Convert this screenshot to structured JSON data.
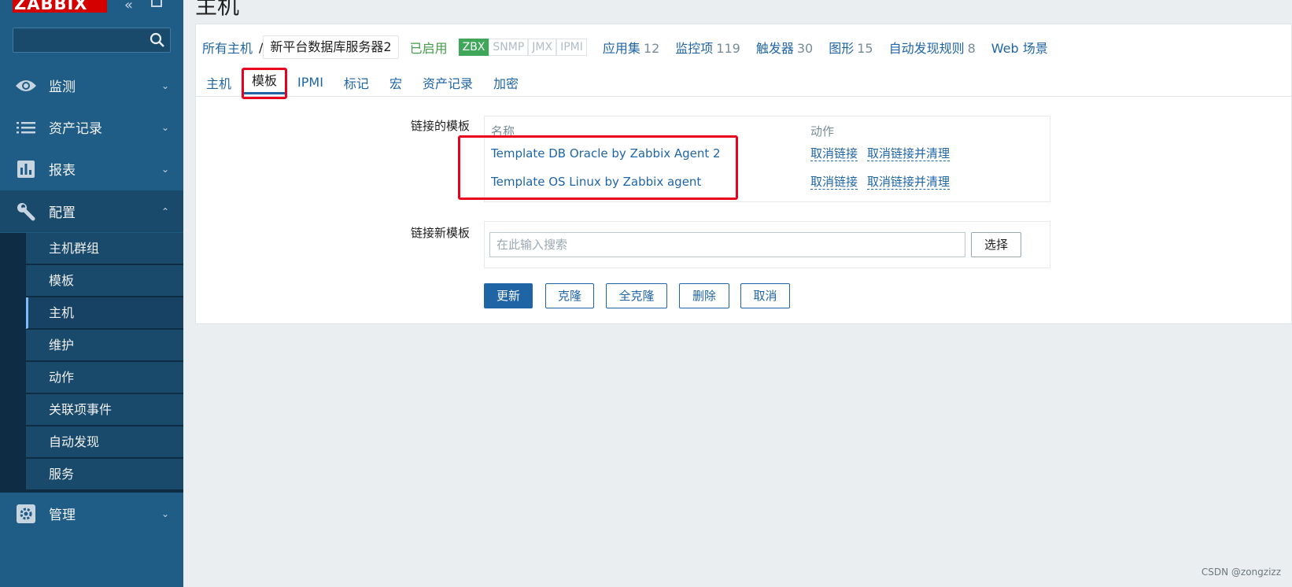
{
  "sidebar": {
    "logo": "ZABBIX",
    "collapse_glyph": "«",
    "nav": [
      {
        "label": "监测",
        "icon": "eye-icon"
      },
      {
        "label": "资产记录",
        "icon": "list-icon"
      },
      {
        "label": "报表",
        "icon": "bar-chart-icon"
      },
      {
        "label": "配置",
        "icon": "wrench-icon"
      },
      {
        "label": "管理",
        "icon": "gear-icon"
      }
    ],
    "config_items": [
      "主机群组",
      "模板",
      "主机",
      "维护",
      "动作",
      "关联项事件",
      "自动发现",
      "服务"
    ],
    "active_item": "主机"
  },
  "page": {
    "title": "主机"
  },
  "breadcrumb": {
    "all_hosts": "所有主机",
    "separator": "/",
    "current_host": "新平台数据库服务器2",
    "status": "已启用"
  },
  "availability": [
    "ZBX",
    "SNMP",
    "JMX",
    "IPMI"
  ],
  "host_links": [
    {
      "label": "应用集",
      "count": "12"
    },
    {
      "label": "监控项",
      "count": "119"
    },
    {
      "label": "触发器",
      "count": "30"
    },
    {
      "label": "图形",
      "count": "15"
    },
    {
      "label": "自动发现规则",
      "count": "8"
    },
    {
      "label": "Web 场景",
      "count": ""
    }
  ],
  "tabs": [
    "主机",
    "模板",
    "IPMI",
    "标记",
    "宏",
    "资产记录",
    "加密"
  ],
  "active_tab": "模板",
  "form": {
    "linked_label": "链接的模板",
    "col_name": "名称",
    "col_action": "动作",
    "templates": [
      {
        "name": "Template DB Oracle by Zabbix Agent 2",
        "unlink": "取消链接",
        "unlink_clear": "取消链接并清理"
      },
      {
        "name": "Template OS Linux by Zabbix agent",
        "unlink": "取消链接",
        "unlink_clear": "取消链接并清理"
      }
    ],
    "new_label": "链接新模板",
    "search_placeholder": "在此输入搜索",
    "select_label": "选择"
  },
  "buttons": {
    "update": "更新",
    "clone": "克隆",
    "full_clone": "全克隆",
    "delete": "删除",
    "cancel": "取消"
  },
  "watermark": "CSDN @zongzizz",
  "colors": {
    "sidebar": "#1f5c86",
    "link": "#1f65a6",
    "highlight": "#e8001c",
    "enabled": "#429e47"
  }
}
